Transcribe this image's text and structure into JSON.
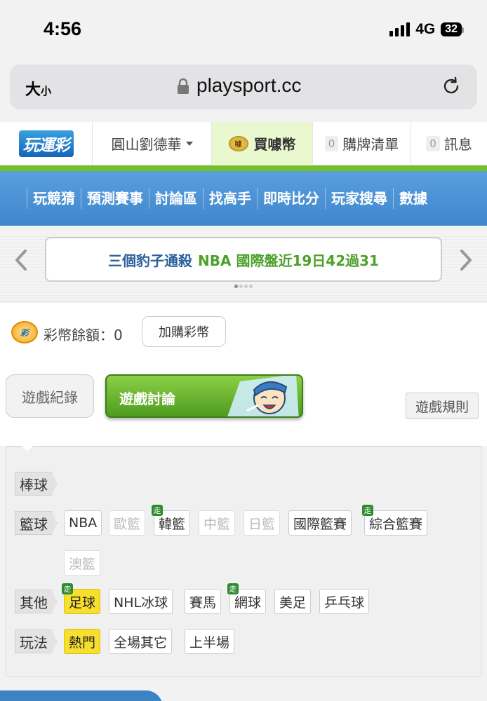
{
  "status_bar": {
    "time": "4:56",
    "network": "4G",
    "battery": "32"
  },
  "browser": {
    "text_size": "大",
    "text_size_small": "小",
    "url": "playsport.cc"
  },
  "header": {
    "logo": "玩運彩",
    "user_menu": "圓山劉德華",
    "buy_coin": "買噱幣",
    "coin_icon": "噱",
    "cart_count": "0",
    "cart_label": "購牌清單",
    "msg_count": "0",
    "msg_label": "訊息"
  },
  "nav": [
    "玩競猜",
    "預測賽事",
    "討論區",
    "找高手",
    "即時比分",
    "玩家搜尋",
    "數據"
  ],
  "ticker": {
    "part1": "三個豹子通殺",
    "part2": "NBA 國際盤近19日42過31"
  },
  "balance": {
    "icon_text": "彩",
    "label": "彩幣餘額：0",
    "topup_button": "加購彩幣"
  },
  "tabs": {
    "record": "遊戲紀錄",
    "discussion": "遊戲討論",
    "rules": "遊戲規則"
  },
  "filter": {
    "baseball": "棒球",
    "basketball": "籃球",
    "basketball_chips": [
      "NBA",
      "歐籃",
      "韓籃",
      "中籃",
      "日籃",
      "國際籃賽",
      "綜合籃賽",
      "澳籃"
    ],
    "other": "其他",
    "other_chips": [
      "足球",
      "NHL冰球",
      "賽馬",
      "網球",
      "美足",
      "乒乓球"
    ],
    "play": "玩法",
    "play_chips": [
      "熱門",
      "全場其它",
      "上半場"
    ],
    "badge": "走"
  },
  "colors": {
    "nav_blue": "#4a91d5",
    "green_accent": "#74bf2a",
    "selected_yellow": "#f7df2e"
  },
  "icons": [
    "signal-icon",
    "battery-icon",
    "lock-icon",
    "reload-icon",
    "caret-down-icon",
    "coin-icon",
    "arrow-left-icon",
    "arrow-right-icon",
    "mascot-icon"
  ]
}
